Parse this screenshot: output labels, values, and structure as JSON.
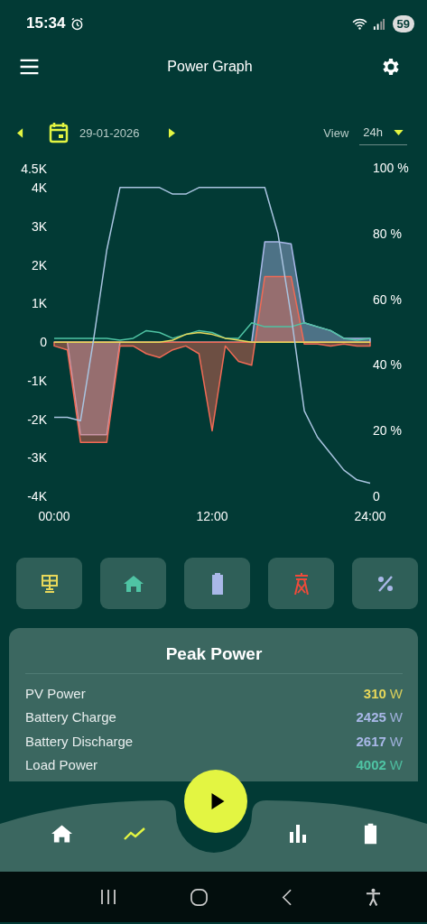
{
  "status_bar": {
    "time": "15:34",
    "battery": "59"
  },
  "header": {
    "title": "Power Graph"
  },
  "toolbar": {
    "date": "29-01-2026",
    "view_label": "View",
    "view_value": "24h"
  },
  "chart": {
    "chart_data": {
      "type": "line",
      "x": [
        0,
        1,
        2,
        3,
        4,
        5,
        6,
        7,
        8,
        9,
        10,
        11,
        12,
        13,
        14,
        15,
        16,
        17,
        18,
        19,
        20,
        21,
        22,
        23,
        24
      ],
      "xticks": [
        {
          "value": 0,
          "label": "00:00"
        },
        {
          "value": 12,
          "label": "12:00"
        },
        {
          "value": 24,
          "label": "24:00"
        }
      ],
      "ylim": [
        -4000,
        4500
      ],
      "yticks": [
        {
          "value": -4000,
          "label": "-4K"
        },
        {
          "value": -3000,
          "label": "-3K"
        },
        {
          "value": -2000,
          "label": "-2K"
        },
        {
          "value": -1000,
          "label": "-1K"
        },
        {
          "value": 0,
          "label": "0"
        },
        {
          "value": 1000,
          "label": "1K"
        },
        {
          "value": 2000,
          "label": "2K"
        },
        {
          "value": 3000,
          "label": "3K"
        },
        {
          "value": 4000,
          "label": "4K"
        },
        {
          "value": 4500,
          "label": "4.5K"
        }
      ],
      "y2lim": [
        0,
        100
      ],
      "y2ticks": [
        {
          "value": 0,
          "label": "0"
        },
        {
          "value": 20,
          "label": "20 %"
        },
        {
          "value": 40,
          "label": "40 %"
        },
        {
          "value": 60,
          "label": "60 %"
        },
        {
          "value": 80,
          "label": "80 %"
        },
        {
          "value": 100,
          "label": "100 %"
        }
      ],
      "xlim": [
        0,
        24
      ],
      "series": [
        {
          "type": "area",
          "color": "#a9b8e8",
          "values": [
            0,
            0,
            -2400,
            -2400,
            -2400,
            0,
            0,
            0,
            0,
            0,
            0,
            0,
            0,
            0,
            0,
            0,
            2600,
            2600,
            2550,
            500,
            400,
            300,
            100,
            100,
            100
          ]
        },
        {
          "type": "area",
          "color": "#f06a55",
          "values": [
            -100,
            -200,
            -2600,
            -2600,
            -2600,
            -100,
            -100,
            -300,
            -400,
            -200,
            -100,
            -300,
            -2300,
            -100,
            -500,
            -600,
            1700,
            1700,
            1700,
            -50,
            -50,
            -100,
            -50,
            -100,
            -100
          ]
        },
        {
          "type": "line",
          "color": "#4fc4a4",
          "values": [
            100,
            100,
            100,
            100,
            100,
            50,
            100,
            300,
            250,
            100,
            200,
            300,
            250,
            100,
            100,
            500,
            400,
            400,
            400,
            500,
            400,
            300,
            100,
            50,
            100
          ]
        },
        {
          "type": "line",
          "color": "#e8d85a",
          "values": [
            0,
            0,
            0,
            0,
            0,
            0,
            0,
            0,
            0,
            50,
            200,
            250,
            200,
            100,
            50,
            0,
            0,
            0,
            0,
            0,
            0,
            0,
            0,
            0,
            0
          ]
        },
        {
          "type": "line",
          "color": "#a9c4e0",
          "axis": "y2",
          "values": [
            24,
            24,
            23,
            48,
            75,
            94,
            94,
            94,
            94,
            92,
            92,
            94,
            94,
            94,
            94,
            94,
            94,
            80,
            55,
            26,
            18,
            13,
            8,
            5,
            4
          ]
        }
      ]
    }
  },
  "filters": [
    {
      "kind": "solar"
    },
    {
      "kind": "house"
    },
    {
      "kind": "battery"
    },
    {
      "kind": "grid"
    },
    {
      "kind": "percent"
    }
  ],
  "peak": {
    "title": "Peak Power",
    "rows": [
      {
        "label": "PV Power",
        "value": "310",
        "unit": "W",
        "color": "#e8d85a"
      },
      {
        "label": "Battery Charge",
        "value": "2425",
        "unit": "W",
        "color": "#a9b8e8"
      },
      {
        "label": "Battery Discharge",
        "value": "2617",
        "unit": "W",
        "color": "#a9b8e8"
      },
      {
        "label": "Load Power",
        "value": "4002",
        "unit": "W",
        "color": "#4fc4a4"
      }
    ]
  },
  "nav": [
    {
      "kind": "home",
      "selected": false
    },
    {
      "kind": "trend",
      "selected": true
    },
    {
      "kind": "play",
      "selected": false
    },
    {
      "kind": "bars",
      "selected": false
    },
    {
      "kind": "battery",
      "selected": false
    }
  ]
}
